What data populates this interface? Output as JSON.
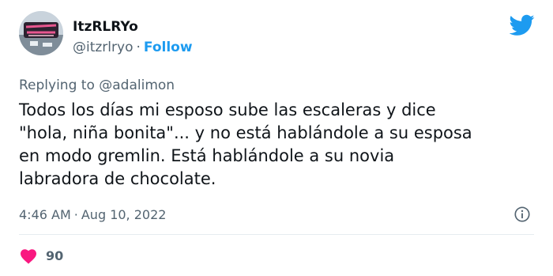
{
  "colors": {
    "accent": "#1d9bf0",
    "secondary_text": "#536471",
    "primary_text": "#0f1419",
    "heart": "#f91880"
  },
  "author": {
    "display_name": "ItzRLRYo",
    "handle": "@itzrlryo",
    "separator": "·",
    "follow_label": "Follow",
    "avatar_icon": "avatar-neon-sign"
  },
  "reply": {
    "prefix": "Replying to",
    "mention": "@adalimon"
  },
  "tweet": {
    "lines": [
      "Todos los días mi esposo sube las escaleras y dice",
      "\"hola, niña bonita\"... y no está hablándole a su esposa",
      "en modo gremlin. Está hablándole a su novia",
      "labradora de chocolate."
    ],
    "time": "4:46 AM",
    "separator": "·",
    "date": "Aug 10, 2022"
  },
  "engagement": {
    "likes": "90",
    "heart_icon": "heart-icon"
  },
  "icons": {
    "brand": "twitter-bird-icon",
    "info": "info-icon"
  }
}
